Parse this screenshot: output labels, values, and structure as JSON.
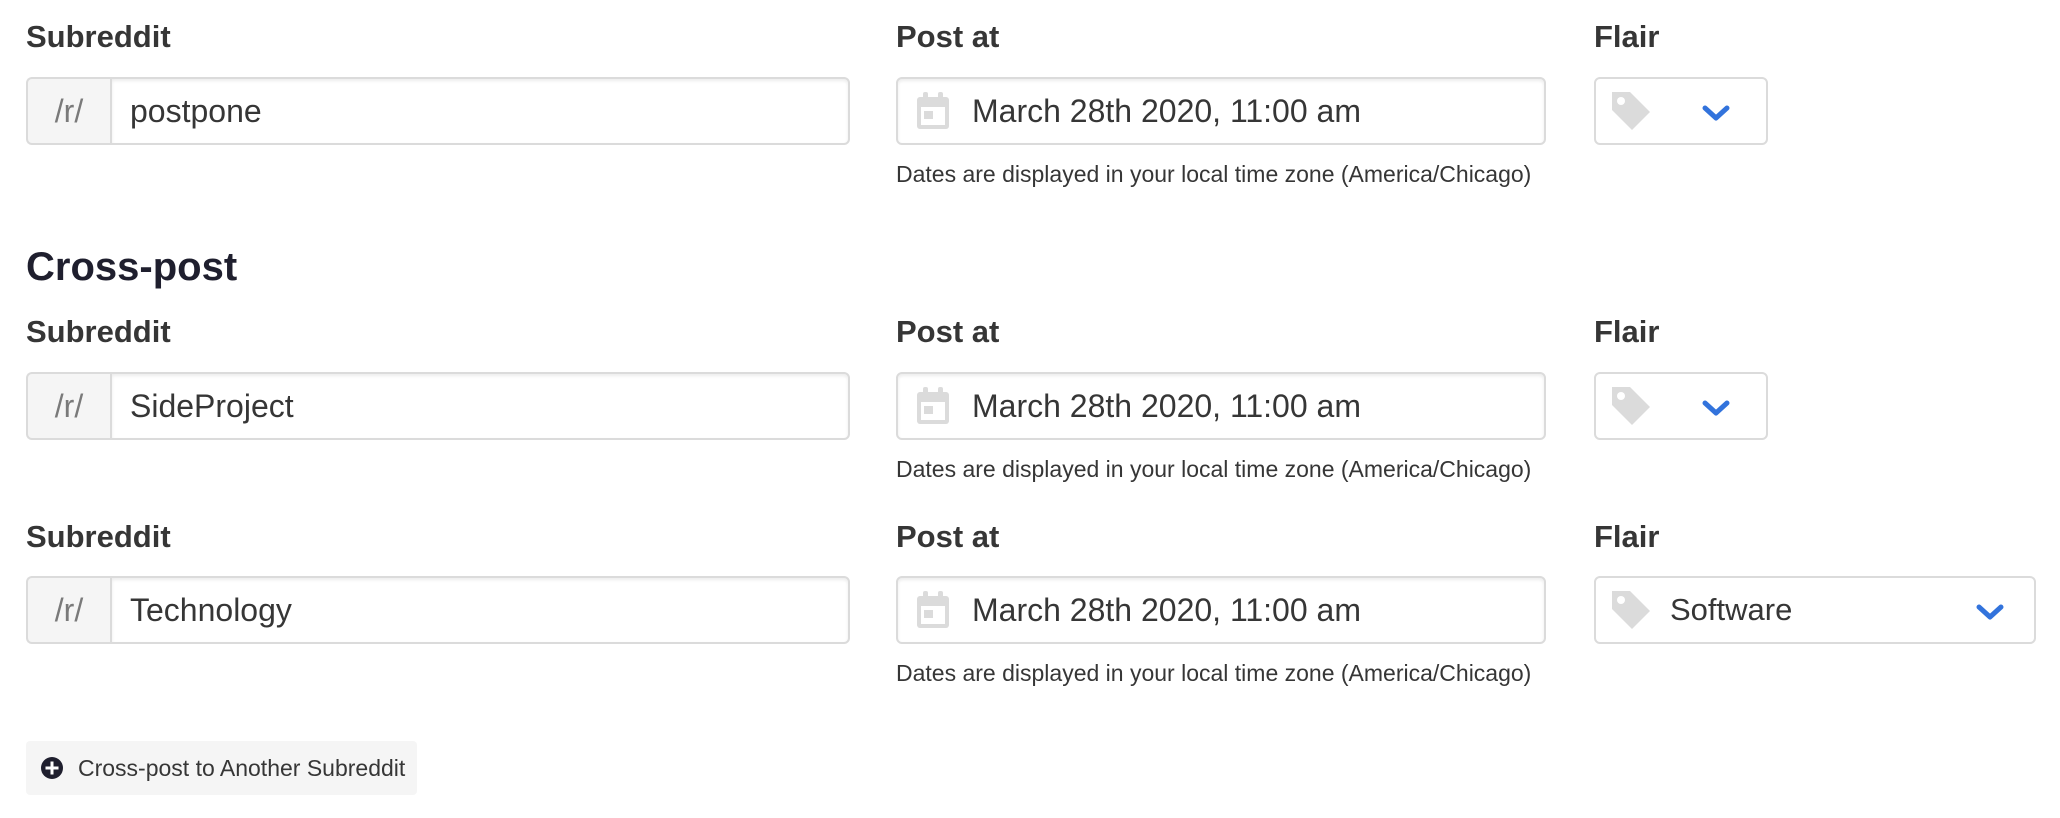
{
  "labels": {
    "subreddit": "Subreddit",
    "post_at": "Post at",
    "flair": "Flair"
  },
  "prefix": "/r/",
  "main_post": {
    "subreddit": "postpone",
    "post_at": "March 28th 2020, 11:00 am",
    "timezone_help": "Dates are displayed in your local time zone (America/Chicago)",
    "flair": ""
  },
  "cross_post": {
    "title": "Cross-post",
    "entries": [
      {
        "subreddit": "SideProject",
        "post_at": "March 28th 2020, 11:00 am",
        "timezone_help": "Dates are displayed in your local time zone (America/Chicago)",
        "flair": ""
      },
      {
        "subreddit": "Technology",
        "post_at": "March 28th 2020, 11:00 am",
        "timezone_help": "Dates are displayed in your local time zone (America/Chicago)",
        "flair": "Software"
      }
    ],
    "add_button_label": "Cross-post to Another Subreddit"
  },
  "icons": {
    "calendar": "calendar-icon",
    "tag": "tag-icon",
    "chevron": "chevron-down-icon",
    "add": "plus-circle-icon"
  },
  "colors": {
    "accent": "#3273dc",
    "icon_gray": "#dbdbdb",
    "text": "#363636",
    "heading": "#1f1f2e"
  }
}
